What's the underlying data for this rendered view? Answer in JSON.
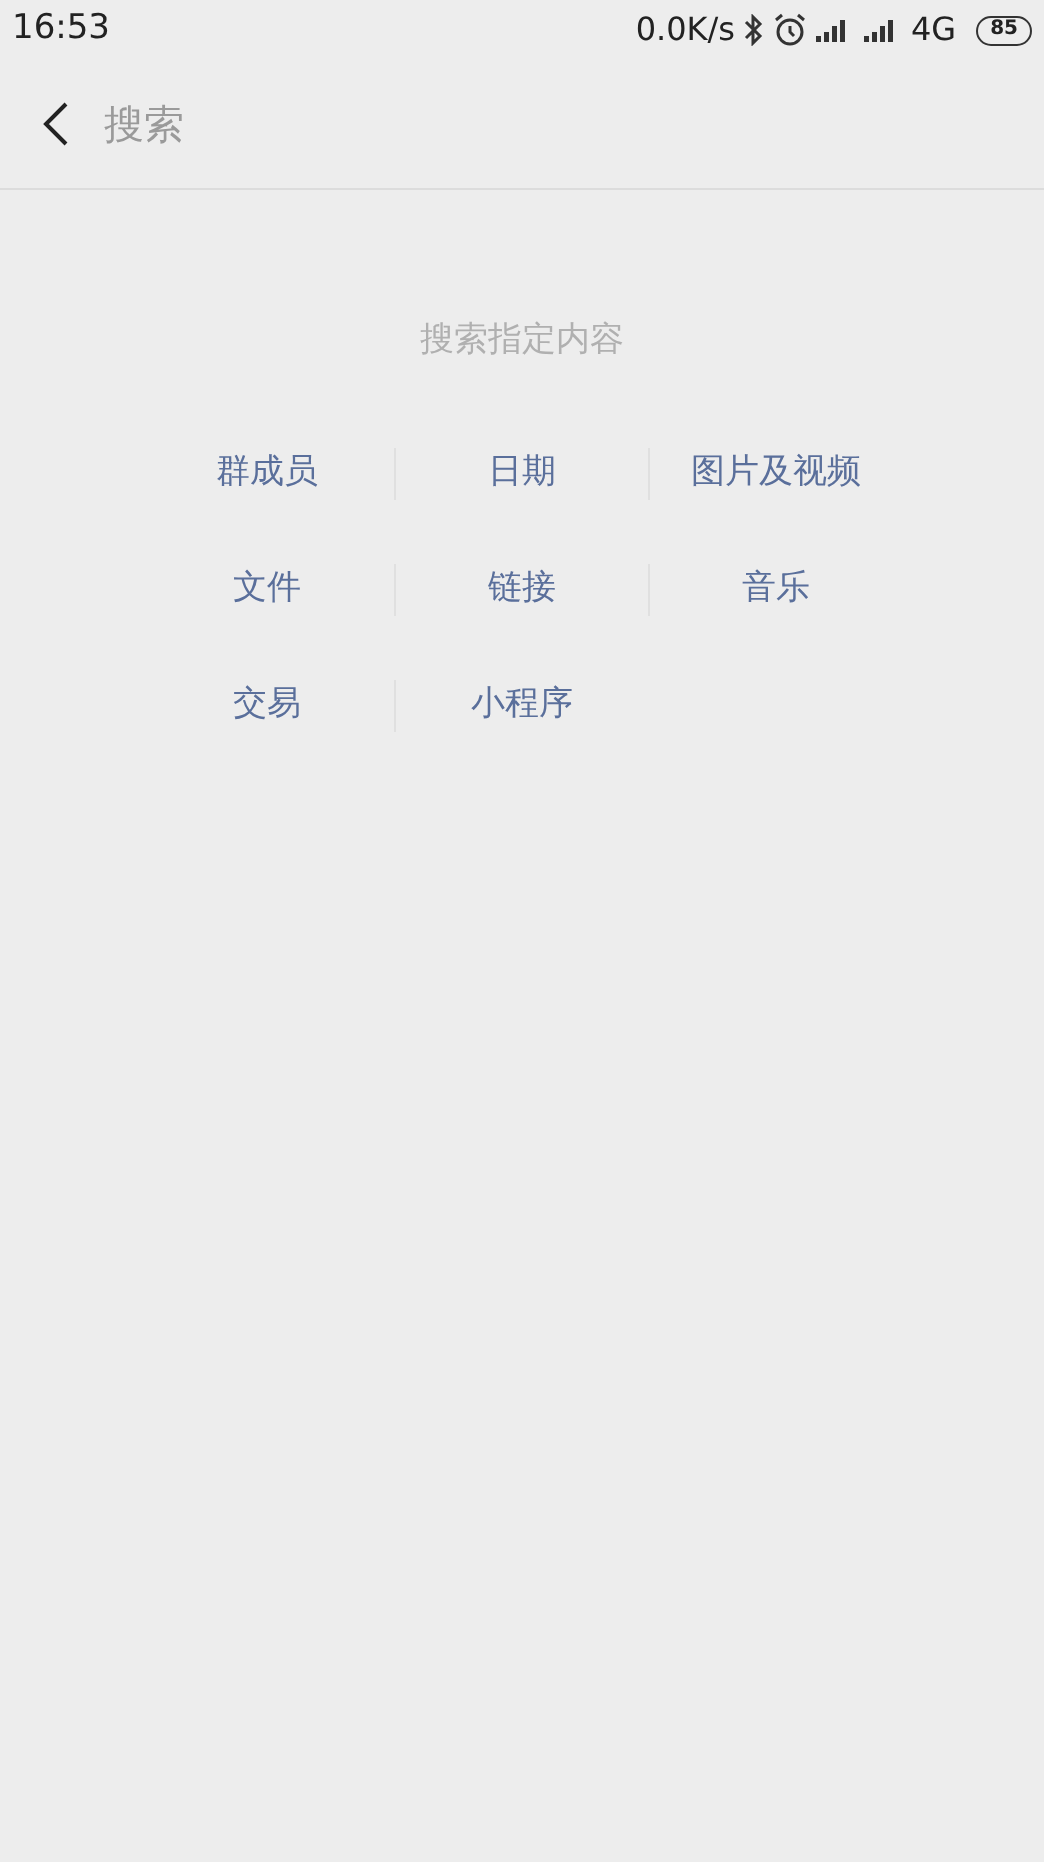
{
  "status_bar": {
    "time": "16:53",
    "speed": "0.0K/s",
    "network": "4G",
    "battery": "85"
  },
  "search": {
    "placeholder": "搜索"
  },
  "section_title": "搜索指定内容",
  "categories": [
    {
      "label": "群成员"
    },
    {
      "label": "日期"
    },
    {
      "label": "图片及视频"
    },
    {
      "label": "文件"
    },
    {
      "label": "链接"
    },
    {
      "label": "音乐"
    },
    {
      "label": "交易"
    },
    {
      "label": "小程序"
    }
  ]
}
